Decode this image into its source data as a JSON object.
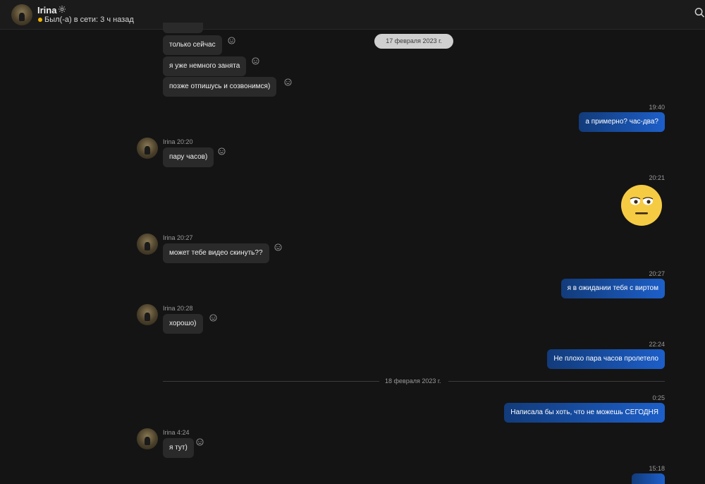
{
  "header": {
    "name": "Irina",
    "status": "Был(-а) в сети: 3 ч назад"
  },
  "date_dividers": {
    "first": "17 февраля 2023 г.",
    "second": "18 февраля 2023 г."
  },
  "messages": [
    {
      "text": "только сейчас"
    },
    {
      "text": "я уже немного занята"
    },
    {
      "text": "позже отпишусь и созвонимся)"
    },
    {
      "time": "19:40",
      "text": "а примерно? час-два?"
    },
    {
      "sender": "Irina 20:20",
      "text": "пару часов)"
    },
    {
      "time": "20:21",
      "sticker": "neutral-face-emoji"
    },
    {
      "sender": "Irina 20:27",
      "text": "может тебе видео скинуть??"
    },
    {
      "time": "20:27",
      "text": "я в ожидании тебя с виртом"
    },
    {
      "sender": "Irina 20:28",
      "text": "хорошо)"
    },
    {
      "time": "22:24",
      "text": "Не плохо пара часов пролетело"
    },
    {
      "time": "0:25",
      "text": "Написала бы хоть, что не можешь СЕГОДНЯ"
    },
    {
      "sender": "Irina 4:24",
      "text": "я тут)"
    },
    {
      "time": "15:18",
      "text": ""
    }
  ],
  "colors": {
    "background": "#141414",
    "incoming_bubble": "#2a2a2a",
    "outgoing_start": "#123b7a",
    "outgoing_end": "#1d5fc9",
    "status_dot": "#f0b400"
  }
}
